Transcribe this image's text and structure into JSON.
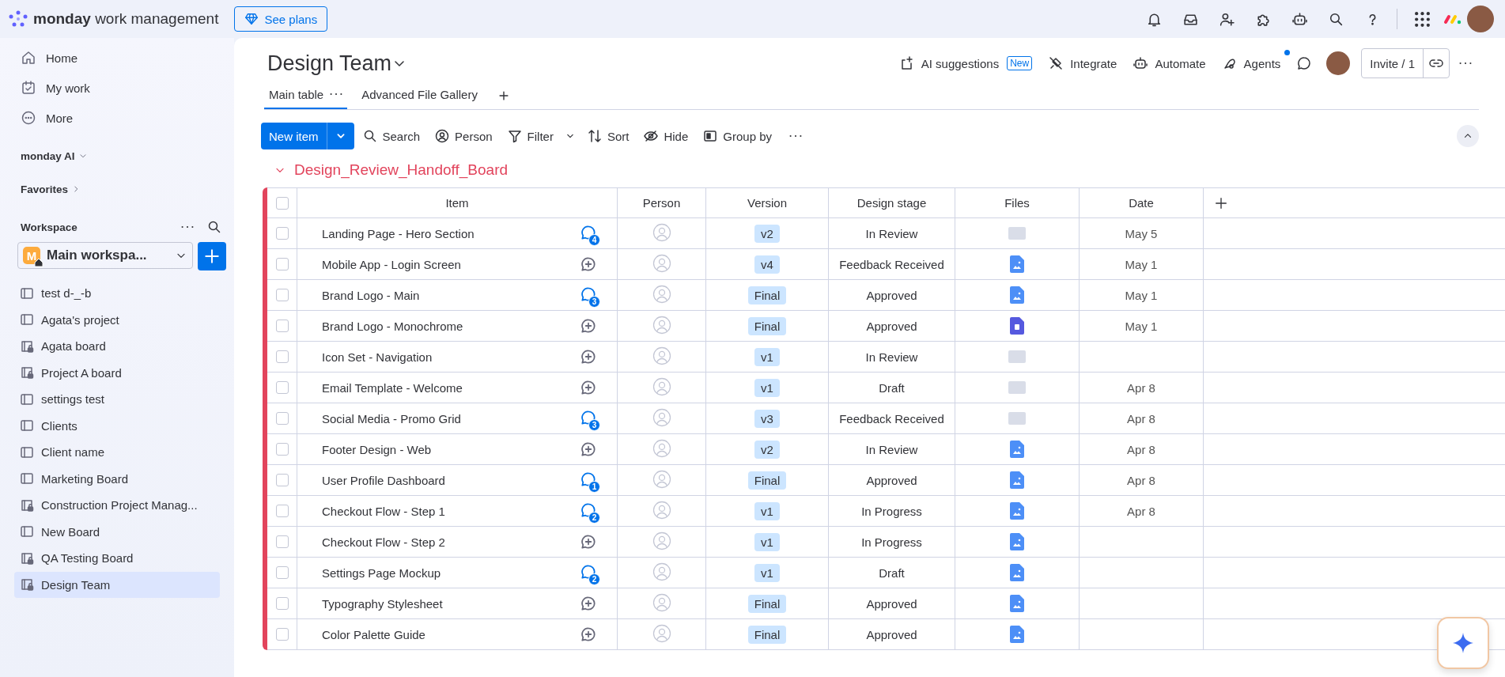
{
  "topbar": {
    "brand": "**monday** work management",
    "plans_button": "See plans"
  },
  "sidebar": {
    "nav": [
      {
        "label": "Home",
        "kind": "home"
      },
      {
        "label": "My work",
        "kind": "calendar"
      },
      {
        "label": "More",
        "kind": "more"
      }
    ],
    "ai_section": "monday AI",
    "favorites": "Favorites",
    "workspace_label": "Workspace",
    "workspace": {
      "badge": "M",
      "name": "Main workspa..."
    },
    "boards": [
      {
        "label": "test d-_-b",
        "kind": "board",
        "selected": false
      },
      {
        "label": "Agata's project",
        "kind": "board",
        "selected": false
      },
      {
        "label": "Agata board",
        "kind": "private",
        "selected": false
      },
      {
        "label": "Project A board",
        "kind": "private",
        "selected": false
      },
      {
        "label": "settings test",
        "kind": "board",
        "selected": false
      },
      {
        "label": "Clients",
        "kind": "board",
        "selected": false
      },
      {
        "label": "Client name",
        "kind": "board",
        "selected": false
      },
      {
        "label": "Marketing Board",
        "kind": "board",
        "selected": false
      },
      {
        "label": "Construction Project Manag...",
        "kind": "private",
        "selected": false
      },
      {
        "label": "New Board",
        "kind": "board",
        "selected": false
      },
      {
        "label": "QA Testing Board",
        "kind": "private",
        "selected": false
      },
      {
        "label": "Design Team",
        "kind": "private",
        "selected": true
      }
    ]
  },
  "board": {
    "title": "Design Team",
    "header_actions": [
      {
        "label": "AI suggestions",
        "kind": "ai",
        "badge": "New",
        "notification": false
      },
      {
        "label": "Integrate",
        "kind": "integrate",
        "notification": false
      },
      {
        "label": "Automate",
        "kind": "robot",
        "notification": false
      },
      {
        "label": "Agents",
        "kind": "agents",
        "notification": true
      }
    ],
    "invite_button": "Invite / 1",
    "tabs": [
      {
        "label": "Main table",
        "selected": true
      },
      {
        "label": "Advanced File Gallery",
        "selected": false
      }
    ],
    "toolbar": {
      "new_item": "New item",
      "tools": [
        {
          "label": "Search",
          "kind": "search"
        },
        {
          "label": "Person",
          "kind": "person"
        },
        {
          "label": "Filter",
          "kind": "filter"
        },
        {
          "label": "Sort",
          "kind": "sort"
        },
        {
          "label": "Hide",
          "kind": "eye"
        },
        {
          "label": "Group by",
          "kind": "group"
        }
      ]
    },
    "group": {
      "title": "Design_Review_Handoff_Board",
      "expanded": true
    },
    "table": {
      "select_all_checked": false,
      "columns": [
        "Item",
        "Person",
        "Version",
        "Design stage",
        "Files",
        "Date"
      ],
      "rows": [
        {
          "checked": false,
          "item": "Landing Page - Hero Section",
          "comments": "4",
          "version": "v2",
          "stage": "In Review",
          "file": {
            "kind": "thumbnail"
          },
          "date": "May 5"
        },
        {
          "checked": false,
          "item": "Mobile App - Login Screen",
          "version": "v4",
          "stage": "Feedback Received",
          "file": {
            "kind": "image"
          },
          "date": "May 1"
        },
        {
          "checked": false,
          "item": "Brand Logo - Main",
          "comments": "3",
          "version": "Final",
          "stage": "Approved",
          "file": {
            "kind": "image"
          },
          "date": "May 1"
        },
        {
          "checked": false,
          "item": "Brand Logo - Monochrome",
          "version": "Final",
          "stage": "Approved",
          "file": {
            "kind": "doc"
          },
          "date": "May 1"
        },
        {
          "checked": false,
          "item": "Icon Set - Navigation",
          "version": "v1",
          "stage": "In Review",
          "file": {
            "kind": "thumbnail"
          }
        },
        {
          "checked": false,
          "item": "Email Template - Welcome",
          "version": "v1",
          "stage": "Draft",
          "file": {
            "kind": "thumbnail"
          },
          "date": "Apr 8"
        },
        {
          "checked": false,
          "item": "Social Media - Promo Grid",
          "comments": "3",
          "version": "v3",
          "stage": "Feedback Received",
          "file": {
            "kind": "thumbnail"
          },
          "date": "Apr 8"
        },
        {
          "checked": false,
          "item": "Footer Design - Web",
          "version": "v2",
          "stage": "In Review",
          "file": {
            "kind": "image"
          },
          "date": "Apr 8"
        },
        {
          "checked": false,
          "item": "User Profile Dashboard",
          "comments": "1",
          "version": "Final",
          "stage": "Approved",
          "file": {
            "kind": "image"
          },
          "date": "Apr 8"
        },
        {
          "checked": false,
          "item": "Checkout Flow - Step 1",
          "comments": "2",
          "version": "v1",
          "stage": "In Progress",
          "file": {
            "kind": "image"
          },
          "date": "Apr 8"
        },
        {
          "checked": false,
          "item": "Checkout Flow - Step 2",
          "version": "v1",
          "stage": "In Progress",
          "file": {
            "kind": "image"
          }
        },
        {
          "checked": false,
          "item": "Settings Page Mockup",
          "comments": "2",
          "version": "v1",
          "stage": "Draft",
          "file": {
            "kind": "image"
          }
        },
        {
          "checked": false,
          "item": "Typography Stylesheet",
          "version": "Final",
          "stage": "Approved",
          "file": {
            "kind": "image"
          }
        },
        {
          "checked": false,
          "item": "Color Palette Guide",
          "version": "Final",
          "stage": "Approved",
          "file": {
            "kind": "image"
          }
        }
      ]
    }
  }
}
